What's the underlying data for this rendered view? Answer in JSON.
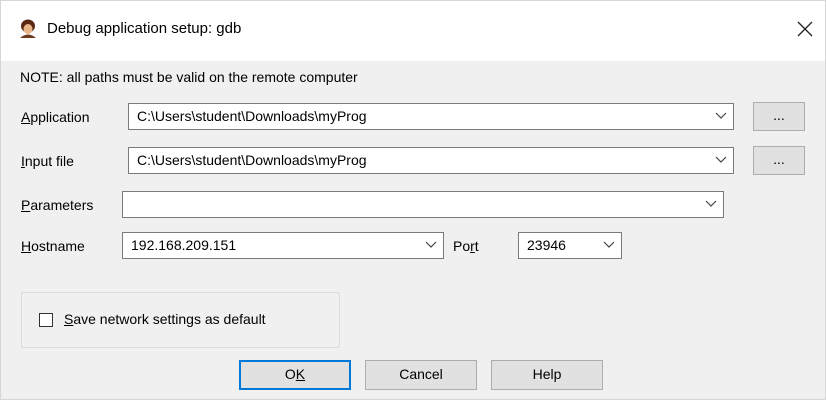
{
  "window": {
    "title": "Debug application setup: gdb",
    "icon": "gdb-app-icon",
    "close_icon": "close-icon"
  },
  "form": {
    "note": "NOTE: all paths must be valid on the remote computer",
    "application": {
      "label_mnemonic": "A",
      "label_rest": "pplication",
      "value": "C:\\Users\\student\\Downloads\\myProg",
      "browse_label": "..."
    },
    "input_file": {
      "label_mnemonic": "I",
      "label_rest": "nput file",
      "value": "C:\\Users\\student\\Downloads\\myProg",
      "browse_label": "..."
    },
    "parameters": {
      "label_mnemonic": "P",
      "label_rest": "arameters",
      "value": ""
    },
    "hostname": {
      "label_mnemonic": "H",
      "label_rest": "ostname",
      "value": "192.168.209.151"
    },
    "port": {
      "label_before": "Po",
      "label_mnemonic": "r",
      "label_after": "t",
      "value": "23946"
    },
    "save_default": {
      "label_mnemonic": "S",
      "label_rest": "ave network settings as default",
      "checked": false
    }
  },
  "buttons": {
    "ok_before": "O",
    "ok_mnemonic": "K",
    "cancel": "Cancel",
    "help": "Help"
  },
  "colors": {
    "accent_border": "#0078d7",
    "face": "#f0f0f0"
  }
}
